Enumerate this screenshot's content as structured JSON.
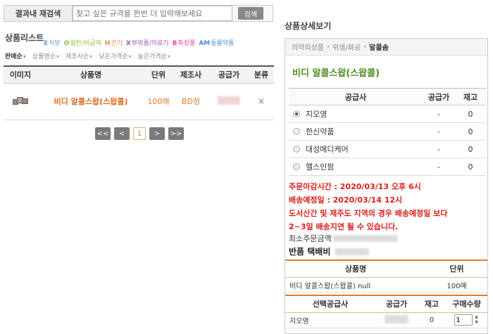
{
  "research": {
    "label": "결과내 재검색",
    "placeholder": "찾고 싶은 규격을 한번 더 입력해보세요",
    "button": "검색"
  },
  "product_list": {
    "title": "상품리스트",
    "legend": [
      {
        "code": "E",
        "text": "처방",
        "color": "#6aa0d8"
      },
      {
        "code": "O",
        "text": "일반/비급여",
        "color": "#8bbd3c"
      },
      {
        "code": "H",
        "text": "건기",
        "color": "#e0863a"
      },
      {
        "code": "X",
        "text": "부외품/의료기",
        "color": "#9b59b6"
      },
      {
        "code": "B",
        "text": "화장품",
        "color": "#d04ea0"
      },
      {
        "code": "AM",
        "text": "동물약품",
        "color": "#4a90d9"
      }
    ],
    "sorts": [
      "판매순",
      "상품명순",
      "제조사순",
      "낮은가격순",
      "높은가격순"
    ],
    "columns": [
      "이미지",
      "상품명",
      "단위",
      "제조사",
      "공급가",
      "분류"
    ],
    "rows": [
      {
        "name": "비디 알콜스왑(스왑콜)",
        "unit": "100매",
        "maker": "BD정",
        "del": "×"
      }
    ],
    "pager": [
      "<<",
      "<",
      "1",
      ">",
      ">>"
    ]
  },
  "detail": {
    "title": "상품상세보기",
    "breadcrumb": [
      "의약외상품",
      "위생/화공",
      "알콜솜"
    ],
    "breadcrumb_sep": "›",
    "product_name": "비디 알콜스왑(스왑콜)",
    "supplier_columns": [
      "공급사",
      "공급가",
      "재고"
    ],
    "suppliers": [
      {
        "name": "지오영",
        "price": "-",
        "stock": "0",
        "selected": true
      },
      {
        "name": "한신약품",
        "price": "-",
        "stock": "0",
        "selected": false
      },
      {
        "name": "대성메디케어",
        "price": "-",
        "stock": "0",
        "selected": false
      },
      {
        "name": "헬스인팜",
        "price": "-",
        "stock": "0",
        "selected": false
      }
    ],
    "notice": [
      "주문마감시간 : 2020/03/13 오후 6시",
      "배송예정일 : 2020/03/14 12시",
      "도서산간 및 제주도 지역의 경우 배송예정일 보다",
      "2~3일 배송지연 될 수 있습니다."
    ],
    "min_order_label": "최소주문금액",
    "return_fee_label": "반품 택배비",
    "product_table": {
      "columns": [
        "상품명",
        "단위"
      ],
      "row": {
        "name": "비디 알콜스왑(스왑콜) null",
        "unit": "100매"
      }
    },
    "buy_table": {
      "columns": [
        "선택공급사",
        "공급가",
        "재고",
        "구매수량"
      ],
      "row": {
        "supplier": "지오영",
        "stock": "0",
        "qty": "1"
      }
    }
  }
}
